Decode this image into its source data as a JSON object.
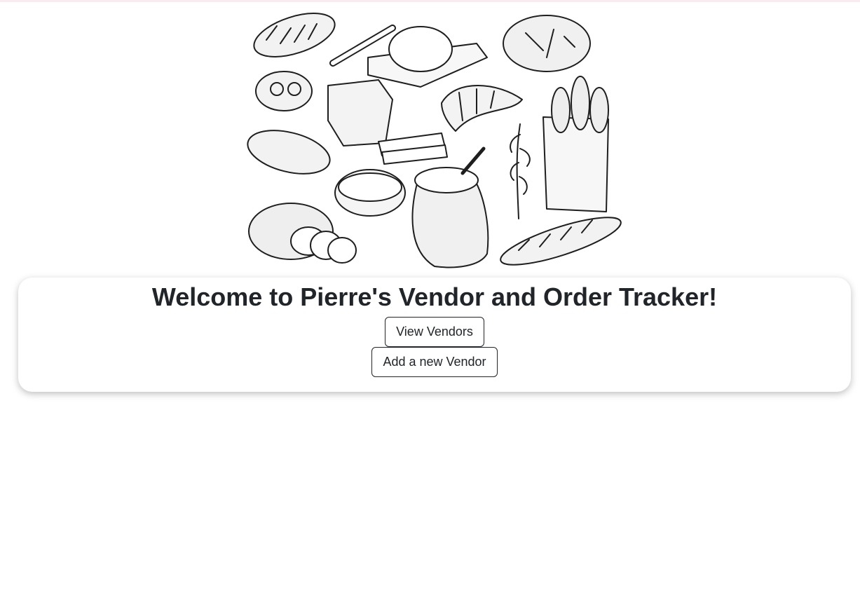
{
  "colors": {
    "accent_strip": "#fbeaf0",
    "text": "#212529",
    "card_background": "#ffffff"
  },
  "hero": {
    "icon": "bakery-illustration"
  },
  "card": {
    "title": "Welcome to Pierre's Vendor and Order Tracker!",
    "view_vendors_label": "View Vendors",
    "add_vendor_label": "Add a new Vendor"
  }
}
